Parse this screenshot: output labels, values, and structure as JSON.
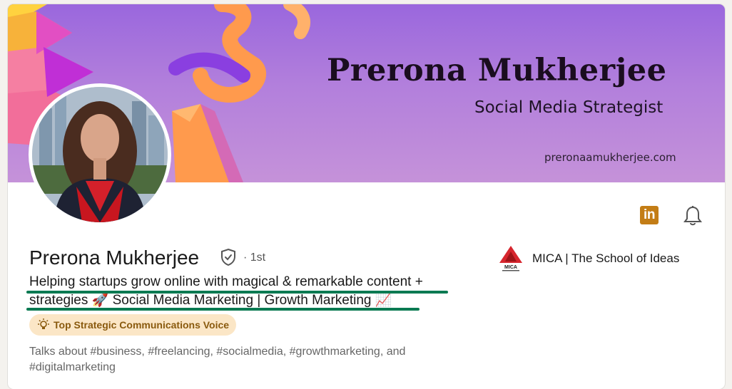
{
  "banner": {
    "name": "Prerona Mukherjee",
    "title": "Social Media Strategist",
    "url": "preronaamukherjee.com"
  },
  "profile": {
    "name": "Prerona Mukherjee",
    "degree": "· 1st",
    "headline_line1": "Helping startups grow online with magical & remarkable content +",
    "headline_line2": "strategies 🚀 Social Media Marketing | Growth Marketing 📈",
    "badge": "Top Strategic Communications Voice",
    "talks_about": "Talks about #business, #freelancing, #socialmedia, #growthmarketing, and #digitalmarketing"
  },
  "actions": {
    "linkedin_icon": "linkedin-icon",
    "bell_icon": "bell-icon",
    "linkedin_glyph": "in"
  },
  "education": {
    "name": "MICA | The School of Ideas",
    "logo_text": "MICA"
  },
  "colors": {
    "banner_start": "#9a67dd",
    "banner_end": "#c592d9",
    "badge_bg": "#fbe6c6",
    "badge_text": "#8a5a0e",
    "underline": "#0a7a52",
    "linkedin_icon_bg": "#c37d16"
  }
}
